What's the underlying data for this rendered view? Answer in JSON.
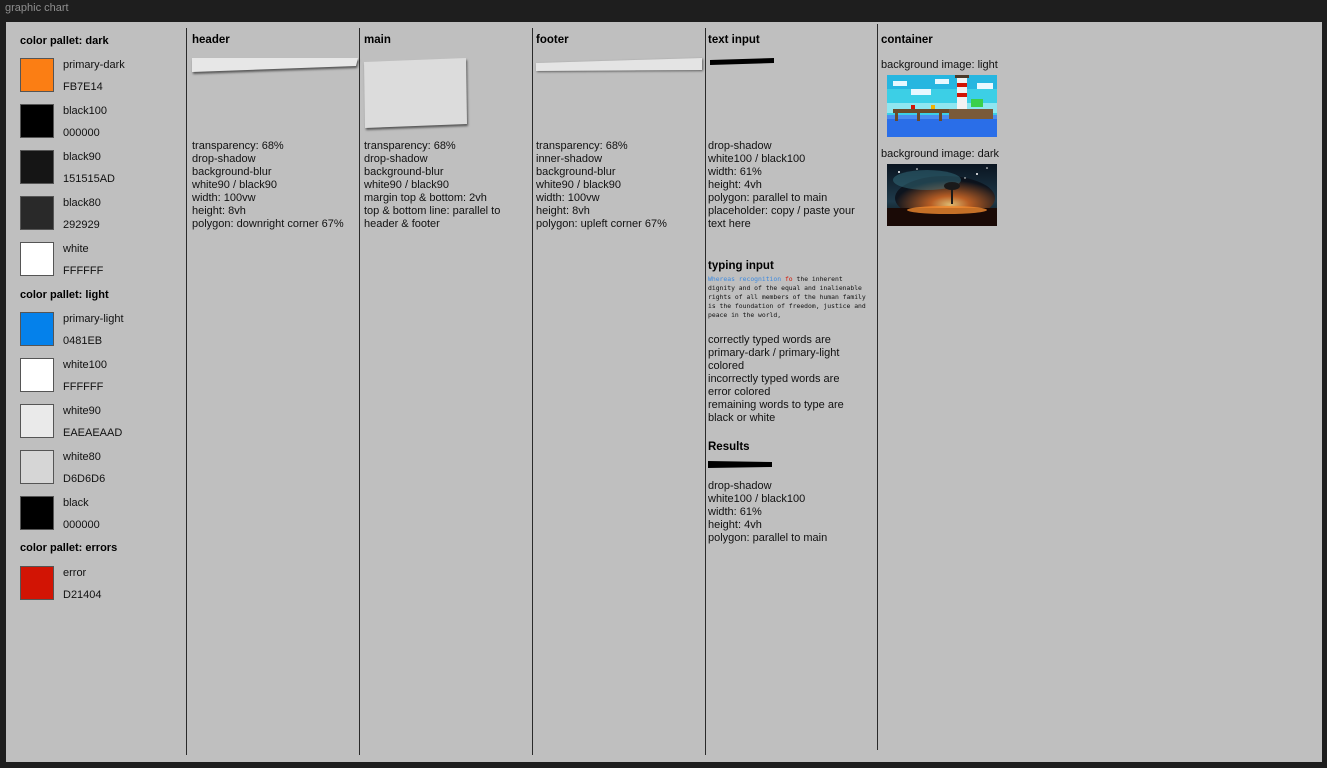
{
  "window": {
    "title": "graphic chart"
  },
  "palette": {
    "dark": {
      "title": "color pallet: dark",
      "items": [
        {
          "name": "primary-dark",
          "hex": "FB7E14",
          "color": "#FB7E14"
        },
        {
          "name": "black100",
          "hex": "000000",
          "color": "#000000"
        },
        {
          "name": "black90",
          "hex": "151515AD",
          "color": "#151515"
        },
        {
          "name": "black80",
          "hex": "292929",
          "color": "#292929"
        },
        {
          "name": "white",
          "hex": "FFFFFF",
          "color": "#FFFFFF"
        }
      ]
    },
    "light": {
      "title": "color pallet: light",
      "items": [
        {
          "name": "primary-light",
          "hex": "0481EB",
          "color": "#0481EB"
        },
        {
          "name": "white100",
          "hex": "FFFFFF",
          "color": "#FFFFFF"
        },
        {
          "name": "white90",
          "hex": "EAEAEAAD",
          "color": "#EAEAEA"
        },
        {
          "name": "white80",
          "hex": "D6D6D6",
          "color": "#D6D6D6"
        },
        {
          "name": "black",
          "hex": "000000",
          "color": "#000000"
        }
      ]
    },
    "errors": {
      "title": "color pallet: errors",
      "items": [
        {
          "name": "error",
          "hex": "D21404",
          "color": "#D21404"
        }
      ]
    }
  },
  "header": {
    "title": "header",
    "lines": [
      "transparency: 68%",
      "drop-shadow",
      "background-blur",
      "white90 / black90",
      "width: 100vw",
      "height: 8vh",
      "polygon: downright corner 67%"
    ]
  },
  "main": {
    "title": "main",
    "lines": [
      "transparency: 68%",
      "drop-shadow",
      "background-blur",
      "white90 / black90",
      "margin top & bottom: 2vh",
      "top & bottom line: parallel to",
      "header & footer"
    ]
  },
  "footer": {
    "title": "footer",
    "lines": [
      "transparency: 68%",
      "inner-shadow",
      "background-blur",
      "white90 / black90",
      "width: 100vw",
      "height: 8vh",
      "polygon: upleft corner 67%"
    ]
  },
  "text_input": {
    "title": "text input",
    "lines": [
      "drop-shadow",
      "white100 / black100",
      "width: 61%",
      "height: 4vh",
      "polygon: parallel to main",
      "placeholder: copy / paste your",
      "text here"
    ]
  },
  "typing_input": {
    "title": "typing input",
    "sample_correct": "Whereas recognition ",
    "sample_error": "fo",
    "sample_rest": " the inherent dignity and of the equal and inalienable rights of all members of the human family is the foundation  of freedom, justice and peace in the world,",
    "lines": [
      "correctly typed words are",
      "primary-dark / primary-light",
      "colored",
      "incorrectly typed words are",
      "error colored",
      "remaining words to type are",
      "black or white"
    ]
  },
  "results": {
    "title": "Results",
    "lines": [
      "drop-shadow",
      "white100 / black100",
      "width: 61%",
      "height: 4vh",
      "polygon: parallel to main"
    ]
  },
  "container": {
    "title": "container",
    "bg_light_label": "background image: light",
    "bg_dark_label": "background image: dark"
  }
}
